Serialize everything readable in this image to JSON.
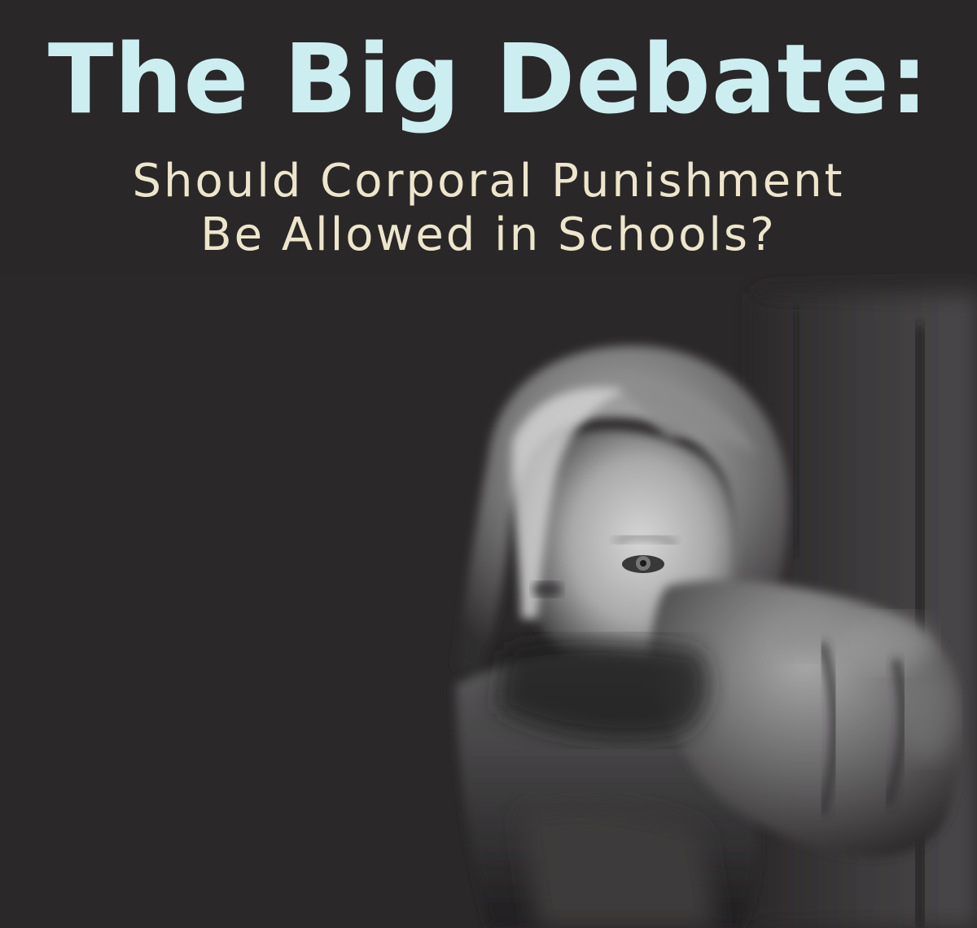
{
  "poster": {
    "title": "The Big Debate:",
    "subtitle_line1": "Should Corporal Punishment",
    "subtitle_line2": "Be Allowed in Schools?"
  },
  "colors": {
    "background": "#2a2829",
    "title": "#cdeef0",
    "subtitle": "#ede6cc"
  },
  "photo": {
    "subject": "black-and-white photo of a child hiding behind a raised fist"
  }
}
